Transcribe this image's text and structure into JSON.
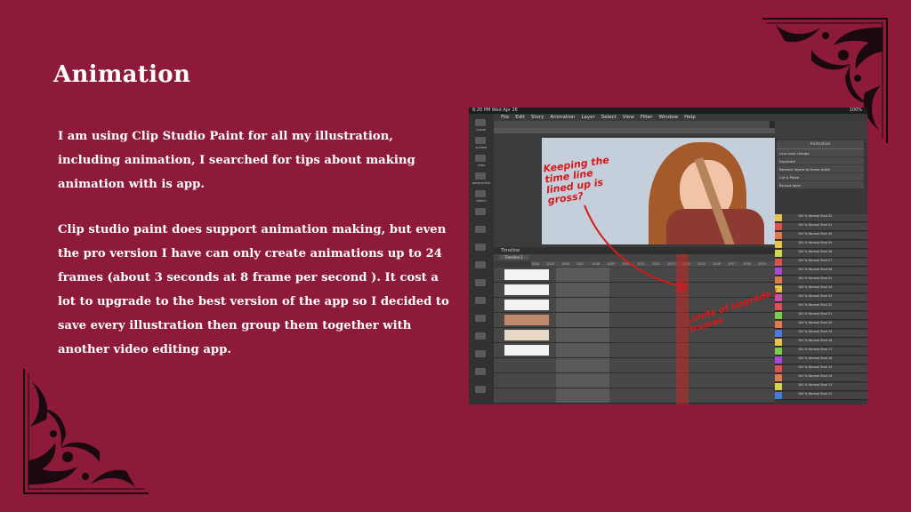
{
  "slide": {
    "title": "Animation",
    "paragraph1": "I am using Clip Studio Paint for all my illustration, including animation, I searched for tips about making animation with is app.",
    "paragraph2": "Clip studio paint does support animation making, but even the pro version I have can only create animations up to 24 frames (about 3 seconds at 8 frame per second ). It cost a lot to upgrade to the best version of the app so I decided to save every illustration then group them together with another video editing app."
  },
  "colors": {
    "background": "#8e1a3a",
    "ornament": "#1a0a10",
    "text": "#ffffff",
    "annotation_red": "#d61919"
  },
  "screenshot": {
    "status_time": "6:20 PM  Wed Apr 26",
    "battery": "100%",
    "menu": [
      "File",
      "Edit",
      "Story",
      "Animation",
      "Layer",
      "Select",
      "View",
      "Filter",
      "Window",
      "Help"
    ],
    "tool_labels": [
      "eraser",
      "symbol",
      "color",
      "perspective",
      "sketch"
    ],
    "annotation_1": "Keeping the time line lined up is gross?",
    "annotation_2": "Limits of upgrade / frames",
    "animation_panel": {
      "title": "Animation",
      "items": [
        "Line color change",
        "Duplicate",
        "Rename layers to frame order",
        "Cut & Paste",
        "Re-sort layer"
      ]
    },
    "timeline_title": "Timeline",
    "timeline_dropdown": "Timeline 1",
    "layer_name_prefix": "100 % Normal",
    "layers": [
      "Shot 32",
      "Shot 31",
      "Shot 30",
      "Shot 29",
      "Shot 28",
      "Shot 27",
      "Shot 26",
      "Shot 25",
      "Shot 24",
      "Shot 23",
      "Shot 22",
      "Shot 21",
      "Shot 20",
      "Shot 19",
      "Shot 18",
      "Shot 17",
      "Shot 16",
      "Shot 15",
      "Shot 14",
      "Shot 13",
      "Shot 12"
    ],
    "layer_colors": [
      "#e6c34a",
      "#e05050",
      "#e07a4a",
      "#e6c34a",
      "#d6d64a",
      "#e05050",
      "#a84ad6",
      "#e07a4a",
      "#e6c34a",
      "#d64aa8",
      "#e05050",
      "#7acb4a",
      "#e07a4a",
      "#4a7ae0",
      "#e6c34a",
      "#7acb4a",
      "#a84ad6",
      "#e05050",
      "#e07a4a",
      "#d6d64a",
      "#4a7ae0"
    ],
    "frame_numbers": [
      "1004",
      "1005",
      "1006",
      "1007",
      "1008",
      "1009",
      "1010",
      "1011",
      "1012",
      "1013",
      "1014",
      "1015",
      "1016",
      "1017",
      "1018",
      "1019"
    ]
  }
}
